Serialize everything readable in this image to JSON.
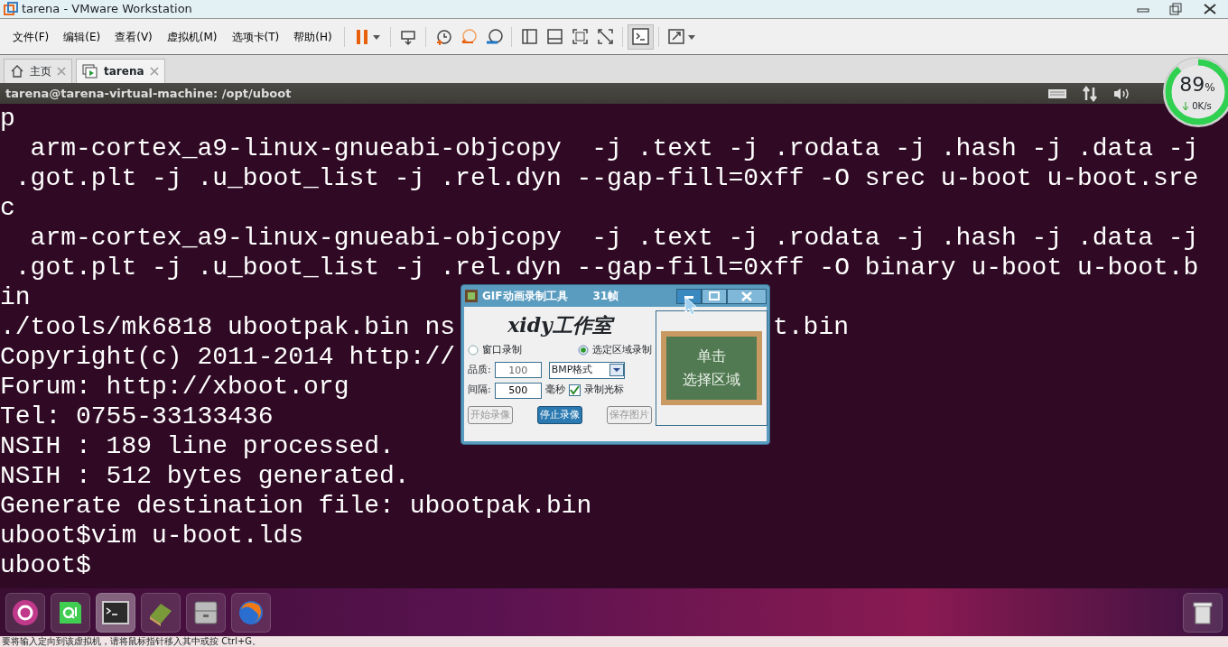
{
  "window": {
    "title": "tarena - VMware Workstation"
  },
  "menu": [
    "文件(F)",
    "编辑(E)",
    "查看(V)",
    "虚拟机(M)",
    "选项卡(T)",
    "帮助(H)"
  ],
  "toolbar": [
    {
      "kind": "pause",
      "selected": false
    },
    {
      "kind": "send-keys",
      "selected": false
    },
    {
      "kind": "snapshot-take",
      "selected": false
    },
    {
      "kind": "snapshot-revert",
      "selected": false
    },
    {
      "kind": "snapshot-manager",
      "selected": false
    },
    {
      "kind": "view-sidebar",
      "selected": false
    },
    {
      "kind": "view-thumbs",
      "selected": false
    },
    {
      "kind": "view-fit",
      "selected": false
    },
    {
      "kind": "view-stretch-off",
      "selected": false
    },
    {
      "kind": "console",
      "selected": true
    },
    {
      "kind": "fullscreen",
      "selected": false
    }
  ],
  "tabs": [
    {
      "label": "主页",
      "kind": "home",
      "selected": false
    },
    {
      "label": "tarena",
      "kind": "vm",
      "selected": true
    }
  ],
  "vm_bar": {
    "title": "tarena@tarena-virtual-machine: /opt/uboot"
  },
  "net_widget": {
    "value": "89",
    "unit": "%",
    "speed": "0K/s",
    "level": 0.89
  },
  "terminal": {
    "lines": [
      {
        "text": "p"
      },
      {
        "text": "  arm-cortex_a9-linux-gnueabi-objcopy  -j .text -j .rodata -j .hash -j .data -j"
      },
      {
        "text": " .got.plt -j .u_boot_list -j .rel.dyn --gap-fill=0xff -O srec u-boot u-boot.sre"
      },
      {
        "text": "c"
      },
      {
        "text": "  arm-cortex_a9-linux-gnueabi-objcopy  -j .text -j .rodata -j .hash -j .data -j"
      },
      {
        "text": " .got.plt -j .u_boot_list -j .rel.dyn --gap-fill=0xff -O binary u-boot u-boot.b"
      },
      {
        "text": "in"
      },
      {
        "text": "./tools/mk6818 ubootpak.bin ns",
        "right": "t.bin"
      },
      {
        "text": "Copyright(c) 2011-2014 http://"
      },
      {
        "text": "Forum: http://xboot.org"
      },
      {
        "text": "Tel: 0755-33133436"
      },
      {
        "text": "NSIH : 189 line processed."
      },
      {
        "text": "NSIH : 512 bytes generated."
      },
      {
        "text": "Generate destination file: ubootpak.bin"
      },
      {
        "text": "uboot$vim u-boot.lds"
      },
      {
        "text": "uboot$"
      }
    ]
  },
  "recorder": {
    "title": "GIF动画录制工具",
    "frames": "31帧",
    "logo": "xidy工作室",
    "modes": [
      {
        "label": "窗口录制",
        "selected": false
      },
      {
        "label": "选定区域录制",
        "selected": true
      }
    ],
    "quality_label": "品质:",
    "quality": "100",
    "format": "BMP格式",
    "interval_label": "间隔:",
    "interval": "500",
    "interval_unit": "毫秒",
    "cursor_option": {
      "label": "录制光标",
      "checked": true
    },
    "buttons": [
      {
        "label": "开始录像",
        "disabled": true
      },
      {
        "label": "停止录像",
        "disabled": false
      },
      {
        "label": "保存图片",
        "disabled": true
      }
    ],
    "board_lines": [
      "单击",
      "选择区域"
    ]
  },
  "launcher": [
    {
      "kind": "ubuntu",
      "focused": false
    },
    {
      "kind": "qt",
      "focused": false
    },
    {
      "kind": "terminal",
      "focused": true
    },
    {
      "kind": "books",
      "focused": false
    },
    {
      "kind": "files",
      "focused": false
    },
    {
      "kind": "browser",
      "focused": false
    }
  ],
  "status_bar": {
    "text": "要将输入定向到该虚拟机，请将鼠标指针移入其中或按 Ctrl+G。"
  }
}
